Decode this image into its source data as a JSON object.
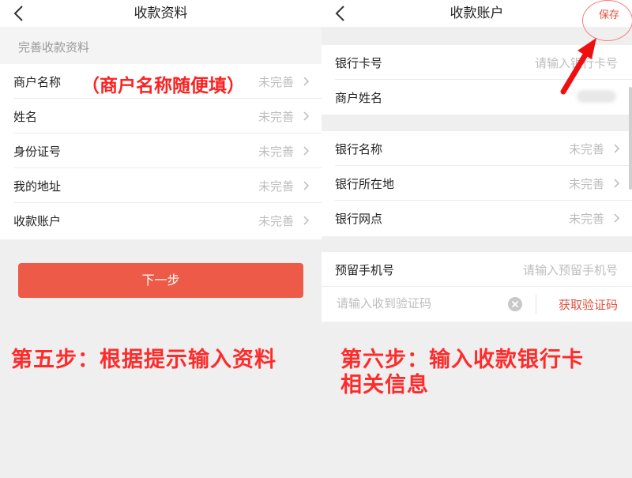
{
  "left": {
    "title": "收款资料",
    "section_title": "完善收款资料",
    "overlay_note": "（商户名称随便填）",
    "rows": [
      {
        "label": "商户名称",
        "value": "未完善"
      },
      {
        "label": "姓名",
        "value": "未完善"
      },
      {
        "label": "身份证号",
        "value": "未完善"
      },
      {
        "label": "我的地址",
        "value": "未完善"
      },
      {
        "label": "收款账户",
        "value": "未完善"
      }
    ],
    "next_button": "下一步",
    "step_note": "第五步：根据提示输入资料"
  },
  "right": {
    "title": "收款账户",
    "save_label": "保存",
    "bank_card_label": "银行卡号",
    "bank_card_placeholder": "请输入银行卡号",
    "merchant_name_label": "商户姓名",
    "bank_rows": [
      {
        "label": "银行名称",
        "value": "未完善"
      },
      {
        "label": "银行所在地",
        "value": "未完善"
      },
      {
        "label": "银行网点",
        "value": "未完善"
      }
    ],
    "phone_label": "预留手机号",
    "phone_placeholder": "请输入预留手机号",
    "code_placeholder": "请输入收到验证码",
    "get_code_label": "获取验证码",
    "step_note_line1": "第六步：输入收款银行卡",
    "step_note_line2": "相关信息"
  },
  "icons": {
    "back": "back-arrow-icon",
    "chevron": "chevron-right-icon",
    "clear": "clear-icon",
    "annotation_arrow": "annotation-arrow"
  },
  "colors": {
    "accent": "#ee5a48",
    "note_red": "#ff2b2b",
    "placeholder_grey": "#bdbdbd"
  }
}
